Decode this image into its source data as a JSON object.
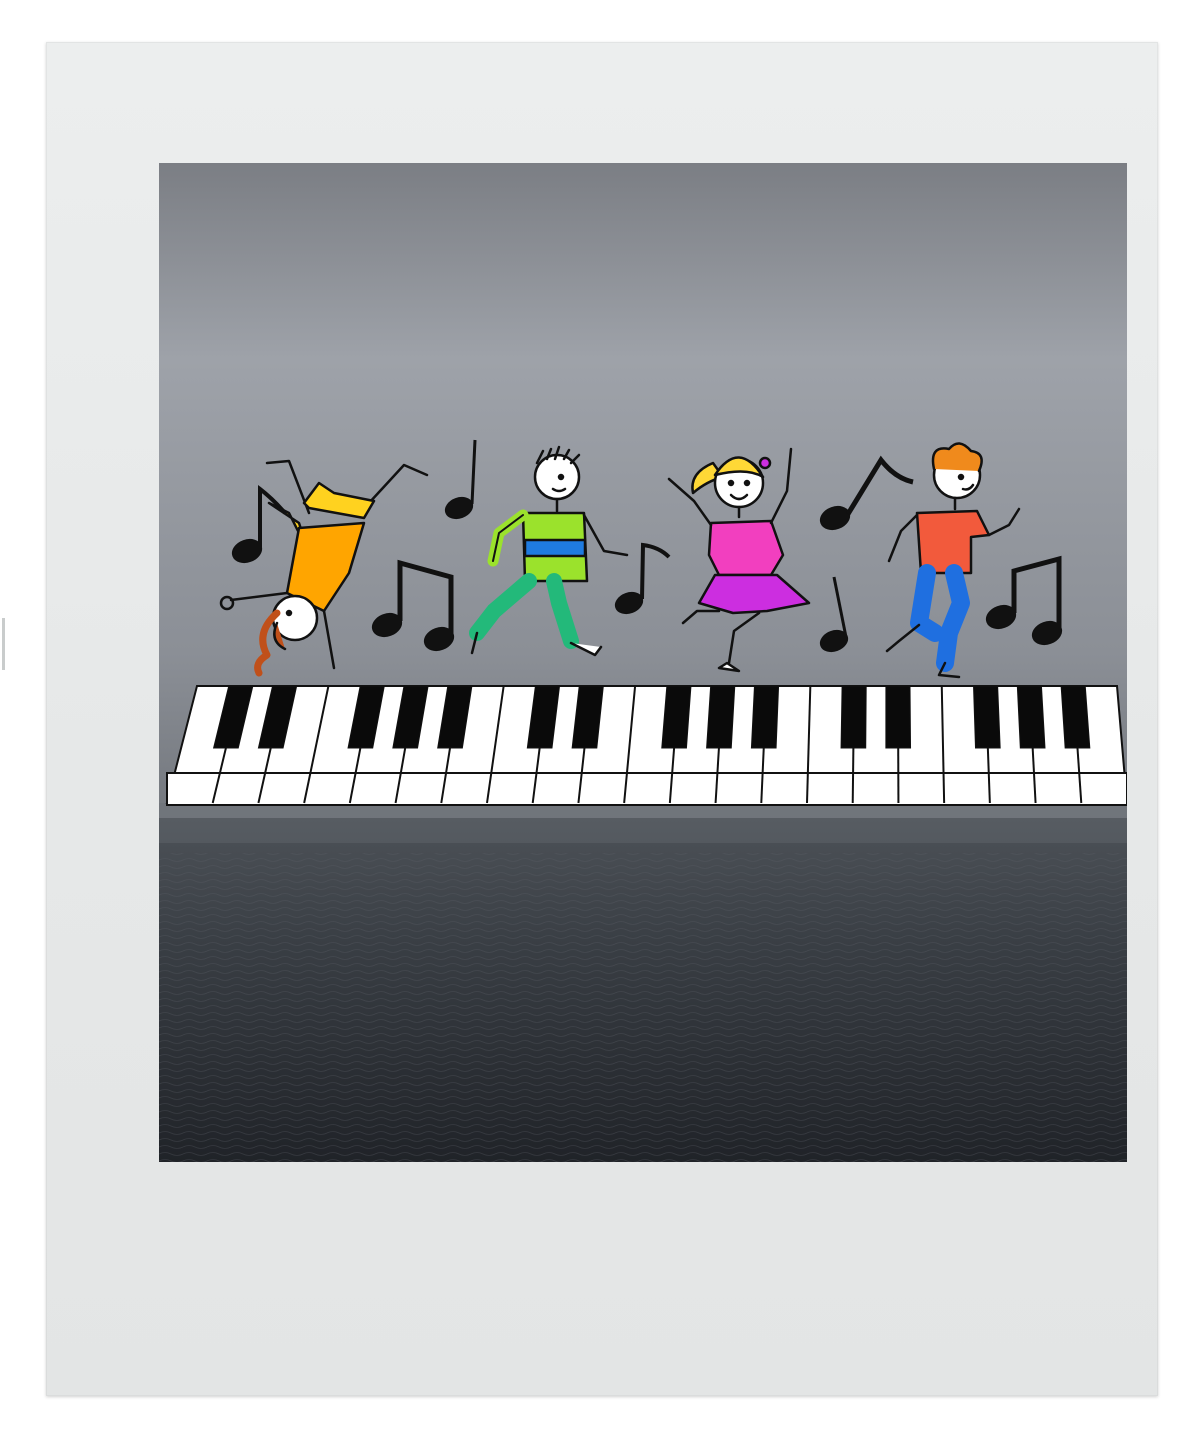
{
  "scene": {
    "colors": {
      "frame": "#e7e9e9",
      "sky_top": "#7b7e84",
      "sky_mid": "#9ea2a9",
      "sea_top": "#4a4f55",
      "sea_bottom": "#22252a",
      "note": "#111111",
      "piano_white": "#ffffff",
      "piano_black": "#0a0a0a"
    },
    "piano": {
      "white_keys": 21
    },
    "characters": [
      {
        "role": "cartwheel-girl",
        "shirt": "#ffa500",
        "pants": "#ffd21f",
        "hair": "#c0501a"
      },
      {
        "role": "running-boy",
        "shirt": "#9be22c",
        "stripe": "#1f7be0",
        "pants": "#23b97a"
      },
      {
        "role": "dancing-girl",
        "shirt": "#f23fbf",
        "skirt": "#cc2ee0",
        "hair": "#ffd836"
      },
      {
        "role": "jumping-boy",
        "shirt": "#f25a3c",
        "pants": "#1f6fe0",
        "hair": "#f08a1c"
      }
    ]
  }
}
